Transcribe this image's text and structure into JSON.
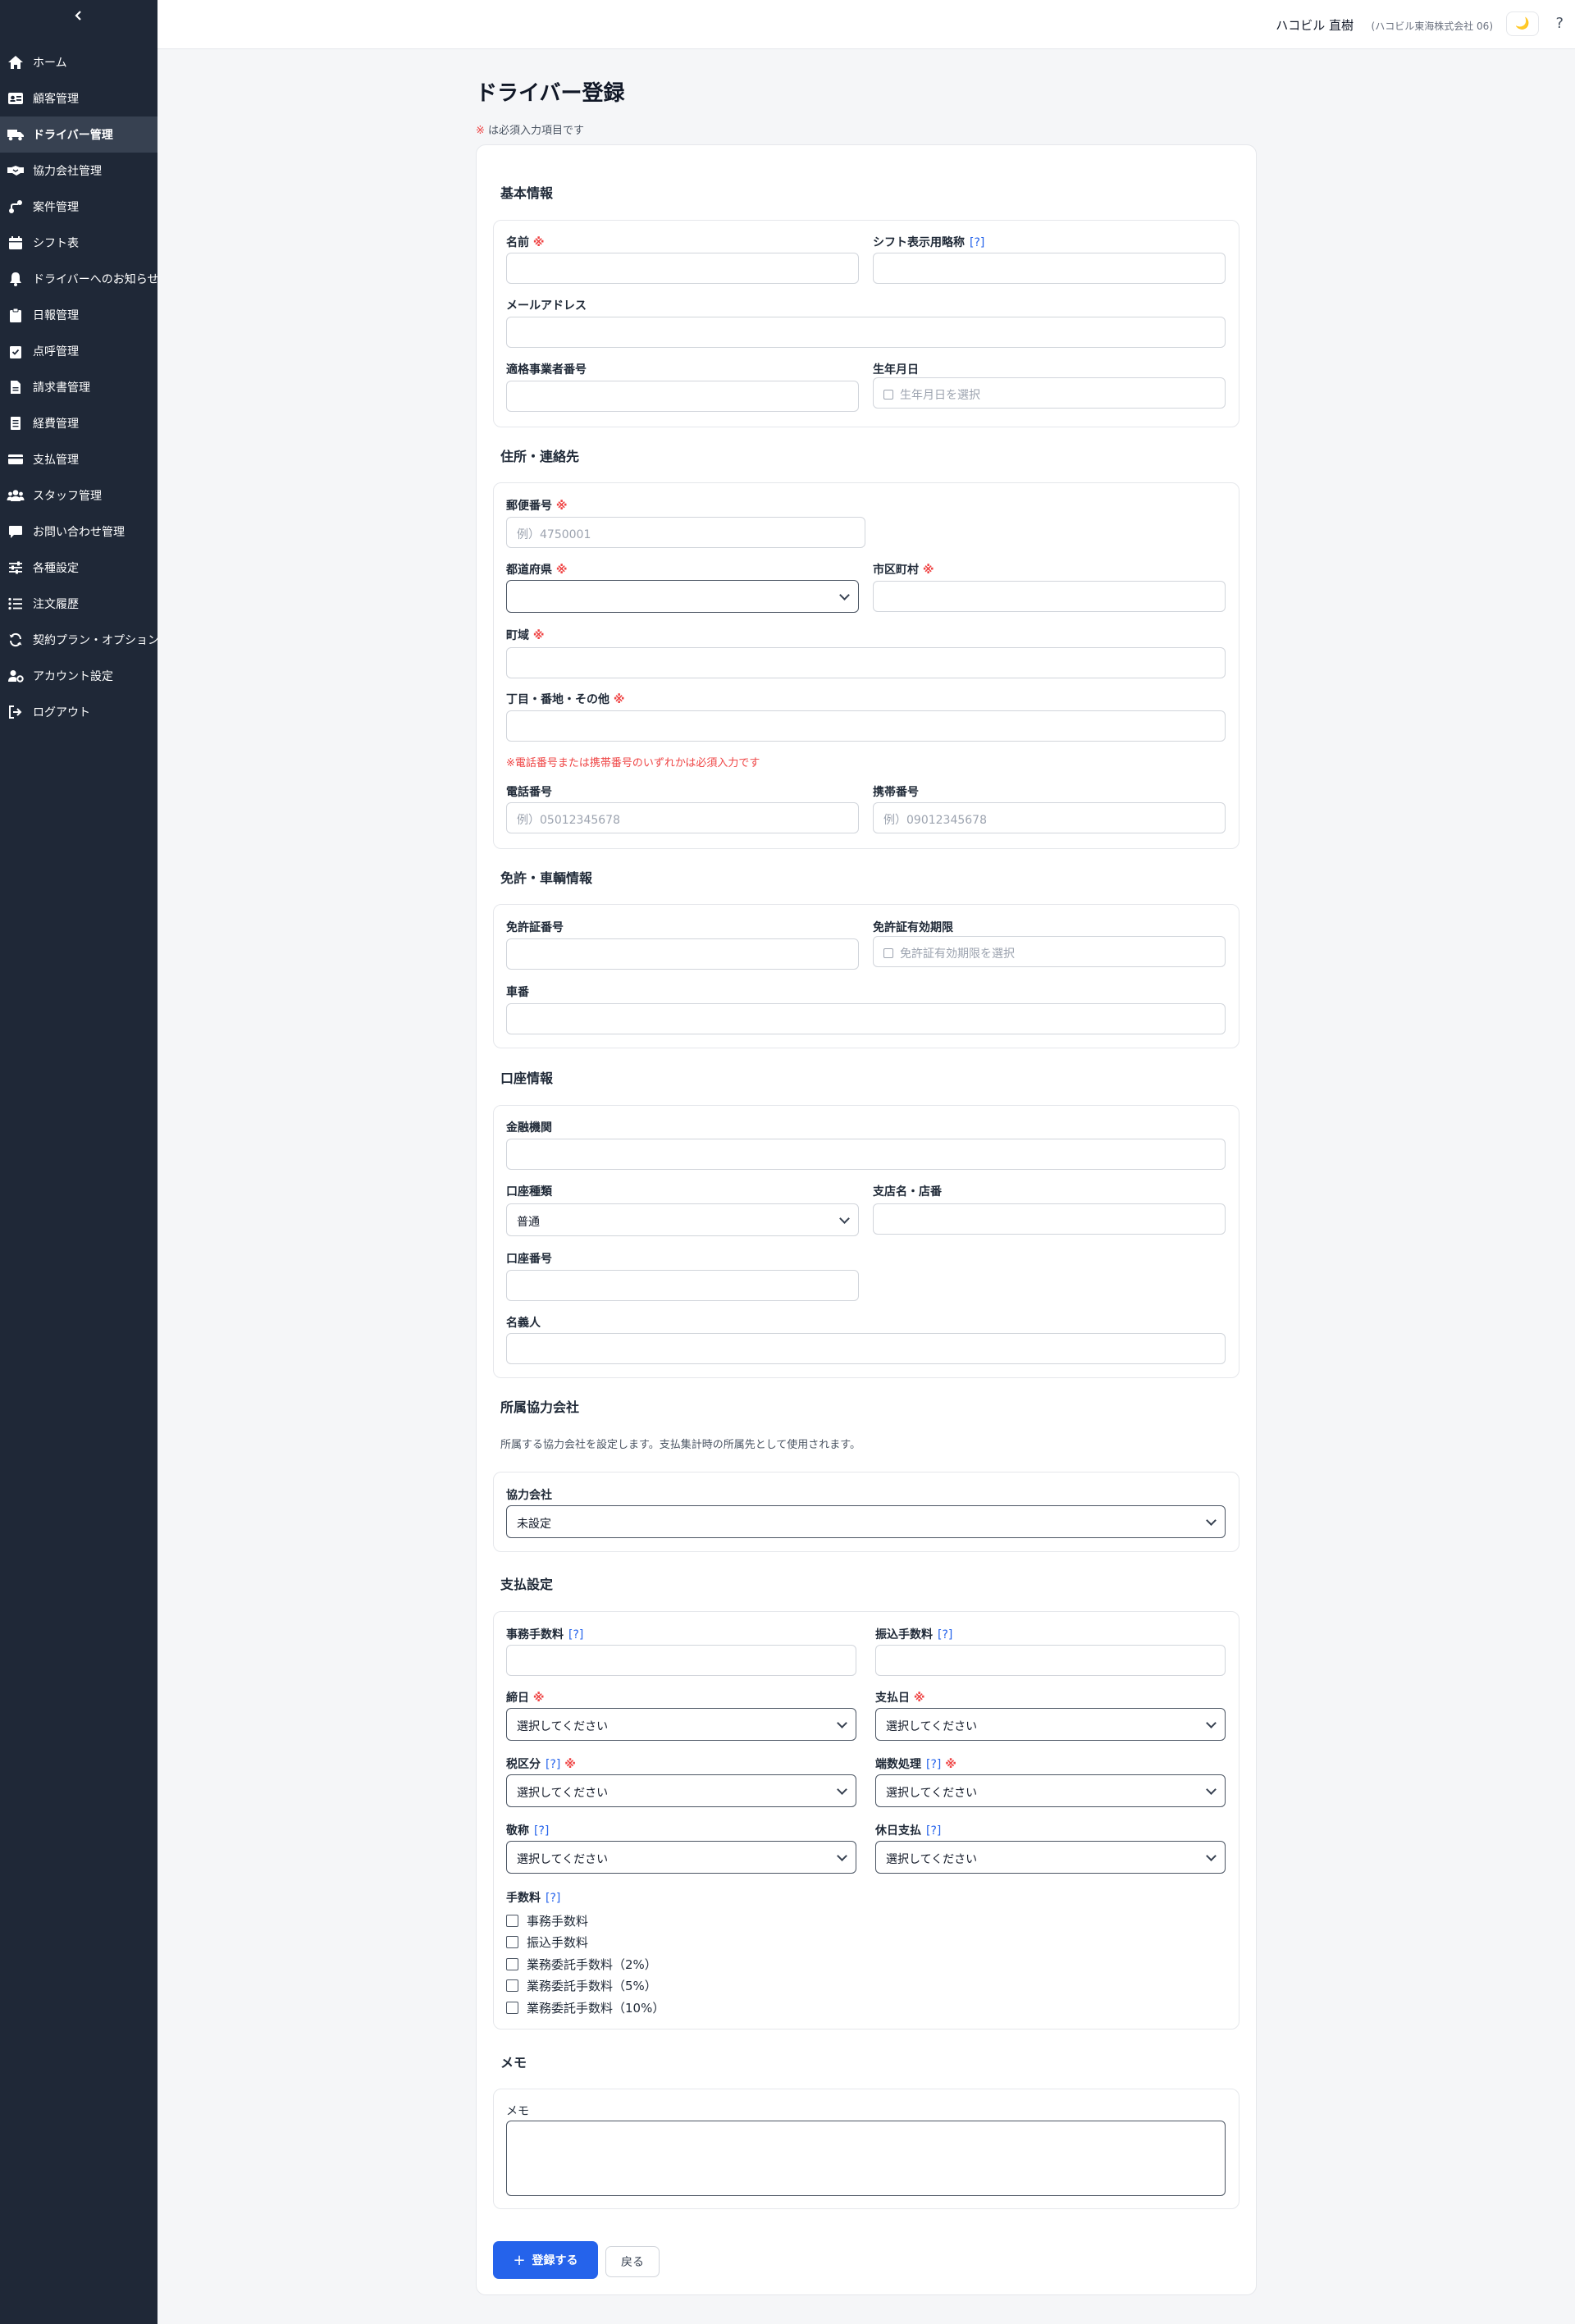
{
  "sidebar": {
    "collapse_icon": "chevron-left-icon",
    "items": [
      {
        "label": "ホーム",
        "icon": "home-icon",
        "active": false
      },
      {
        "label": "顧客管理",
        "icon": "id-card-icon",
        "active": false
      },
      {
        "label": "ドライバー管理",
        "icon": "truck-icon",
        "active": true
      },
      {
        "label": "協力会社管理",
        "icon": "handshake-icon",
        "active": false
      },
      {
        "label": "案件管理",
        "icon": "route-icon",
        "active": false
      },
      {
        "label": "シフト表",
        "icon": "calendar-icon",
        "active": false
      },
      {
        "label": "ドライバーへのお知らせ",
        "icon": "bell-icon",
        "active": false
      },
      {
        "label": "日報管理",
        "icon": "clipboard-icon",
        "active": false
      },
      {
        "label": "点呼管理",
        "icon": "clipboard-check-icon",
        "active": false
      },
      {
        "label": "請求書管理",
        "icon": "file-icon",
        "active": false
      },
      {
        "label": "経費管理",
        "icon": "receipt-icon",
        "active": false
      },
      {
        "label": "支払管理",
        "icon": "credit-card-icon",
        "active": false
      },
      {
        "label": "スタッフ管理",
        "icon": "users-icon",
        "active": false
      },
      {
        "label": "お問い合わせ管理",
        "icon": "message-icon",
        "active": false
      },
      {
        "label": "各種設定",
        "icon": "sliders-icon",
        "active": false
      },
      {
        "label": "注文履歴",
        "icon": "list-icon",
        "active": false
      },
      {
        "label": "契約プラン・オプション",
        "icon": "refresh-icon",
        "active": false
      },
      {
        "label": "アカウント設定",
        "icon": "user-cog-icon",
        "active": false
      },
      {
        "label": "ログアウト",
        "icon": "logout-icon",
        "active": false
      }
    ]
  },
  "header": {
    "user_name": "ハコビル 直樹",
    "company": "(ハコビル東海株式会社 06)",
    "theme_icon": "🌙",
    "help": "?"
  },
  "page": {
    "title": "ドライバー登録",
    "required_mark": "※",
    "required_note": "は必須入力項目です"
  },
  "marks": {
    "required": "※",
    "help": "[?]"
  },
  "basic": {
    "heading": "基本情報",
    "name_label": "名前",
    "shift_name_label": "シフト表示用略称",
    "email_label": "メールアドレス",
    "invoice_no_label": "適格事業者番号",
    "birthdate_label": "生年月日",
    "birthdate_placeholder": "生年月日を選択"
  },
  "address": {
    "heading": "住所・連絡先",
    "postal_label": "郵便番号",
    "postal_placeholder": "例）4750001",
    "prefecture_label": "都道府県",
    "prefecture_value": "",
    "city_label": "市区町村",
    "town_label": "町域",
    "street_label": "丁目・番地・その他",
    "phone_note": "※電話番号または携帯番号のいずれかは必須入力です",
    "phone_label": "電話番号",
    "phone_placeholder": "例）05012345678",
    "mobile_label": "携帯番号",
    "mobile_placeholder": "例）09012345678"
  },
  "license": {
    "heading": "免許・車輌情報",
    "license_no_label": "免許証番号",
    "expiry_label": "免許証有効期限",
    "expiry_placeholder": "免許証有効期限を選択",
    "vehicle_no_label": "車番"
  },
  "bank": {
    "heading": "口座情報",
    "institution_label": "金融機関",
    "account_type_label": "口座種類",
    "account_type_value": "普通",
    "branch_label": "支店名・店番",
    "account_no_label": "口座番号",
    "holder_label": "名義人"
  },
  "partner": {
    "heading": "所属協力会社",
    "description": "所属する協力会社を設定します。支払集計時の所属先として使用されます。",
    "company_label": "協力会社",
    "company_value": "未設定"
  },
  "payment": {
    "heading": "支払設定",
    "office_fee_label": "事務手数料",
    "transfer_fee_label": "振込手数料",
    "closing_day_label": "締日",
    "pay_day_label": "支払日",
    "tax_label": "税区分",
    "rounding_label": "端数処理",
    "honorific_label": "敬称",
    "holiday_label": "休日支払",
    "select_placeholder": "選択してください",
    "fees_label": "手数料",
    "fees": [
      "事務手数料",
      "振込手数料",
      "業務委託手数料（2%）",
      "業務委託手数料（5%）",
      "業務委託手数料（10%）"
    ]
  },
  "memo": {
    "heading": "メモ",
    "label": "メモ"
  },
  "actions": {
    "submit_icon": "+",
    "submit_label": "登録する",
    "back_label": "戻る"
  },
  "colors": {
    "sidebar": "#1f2837",
    "active_item": "#374151",
    "primary": "#2563eb",
    "required": "#ef4444",
    "help_link": "#2563eb"
  }
}
